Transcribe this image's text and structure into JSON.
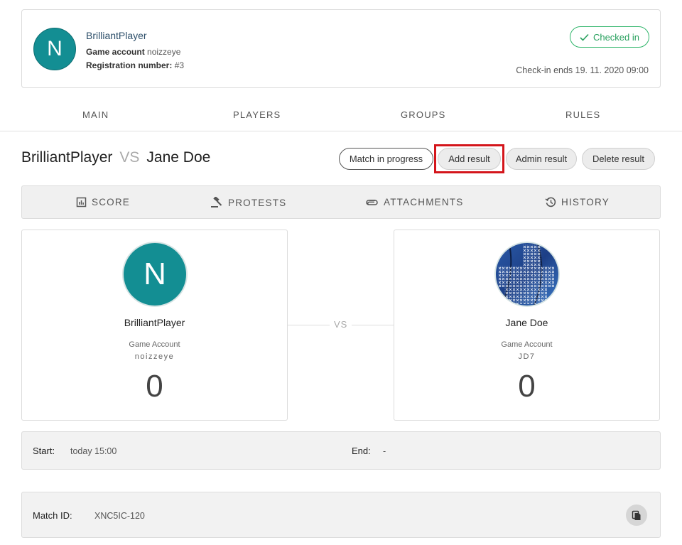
{
  "player_card": {
    "avatar_letter": "N",
    "name": "BrilliantPlayer",
    "game_account_label": "Game account",
    "game_account_value": "noizzeye",
    "registration_label": "Registration number:",
    "registration_value": "#3",
    "status_badge": "Checked in",
    "checkin_ends": "Check-in ends 19. 11. 2020 09:00",
    "status_color": "#27a05d"
  },
  "main_nav": {
    "tabs": [
      {
        "label": "MAIN"
      },
      {
        "label": "PLAYERS"
      },
      {
        "label": "GROUPS"
      },
      {
        "label": "RULES"
      }
    ]
  },
  "match": {
    "player1": "BrilliantPlayer",
    "vs": "VS",
    "player2": "Jane Doe",
    "buttons": {
      "status": "Match in progress",
      "add_result": "Add result",
      "admin_result": "Admin result",
      "delete_result": "Delete result"
    },
    "highlight_color": "#d4151b"
  },
  "sub_tabs": [
    {
      "label": "SCORE",
      "icon": "score-icon"
    },
    {
      "label": "PROTESTS",
      "icon": "gavel-icon"
    },
    {
      "label": "ATTACHMENTS",
      "icon": "paperclip-icon"
    },
    {
      "label": "HISTORY",
      "icon": "history-icon"
    }
  ],
  "players": {
    "left": {
      "avatar_letter": "N",
      "name": "BrilliantPlayer",
      "game_account_label": "Game Account",
      "game_account_value": "noizzeye",
      "score": "0"
    },
    "vs": "VS",
    "right": {
      "name": "Jane Doe",
      "game_account_label": "Game Account",
      "game_account_value": "JD7",
      "score": "0"
    }
  },
  "times": {
    "start_label": "Start:",
    "start_value": "today 15:00",
    "end_label": "End:",
    "end_value": "-"
  },
  "match_id": {
    "label": "Match ID:",
    "value": "XNC5IC-120"
  }
}
